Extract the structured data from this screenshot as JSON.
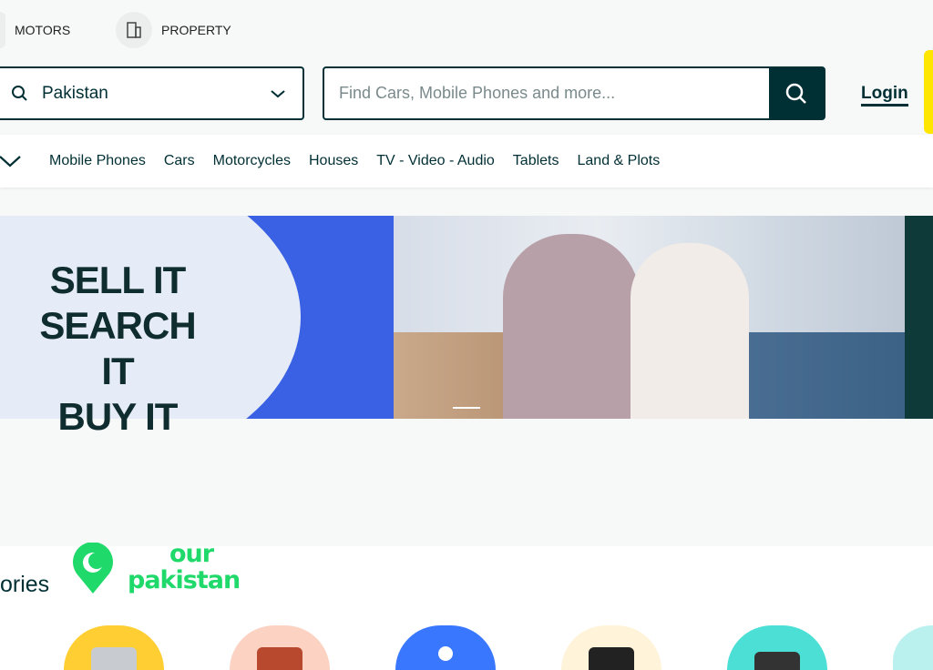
{
  "top_categories": [
    {
      "label": "MOTORS",
      "icon": "car-icon"
    },
    {
      "label": "PROPERTY",
      "icon": "building-icon"
    }
  ],
  "location": {
    "value": "Pakistan"
  },
  "search": {
    "placeholder": "Find Cars, Mobile Phones and more..."
  },
  "login_label": "Login",
  "nav_categories": [
    "Mobile Phones",
    "Cars",
    "Motorcycles",
    "Houses",
    "TV - Video - Audio",
    "Tablets",
    "Land & Plots"
  ],
  "banner": {
    "lines": [
      "SELL IT",
      "SEARCH IT",
      "BUY IT"
    ]
  },
  "section": {
    "title_partial": "ories",
    "logo_text": [
      "OUR",
      "PAKISTAN"
    ]
  },
  "category_colors": [
    "#ffce32",
    "#fcd3c3",
    "#3a77ff",
    "#fff4d9",
    "#4bdfd6",
    "#baf1ef"
  ]
}
